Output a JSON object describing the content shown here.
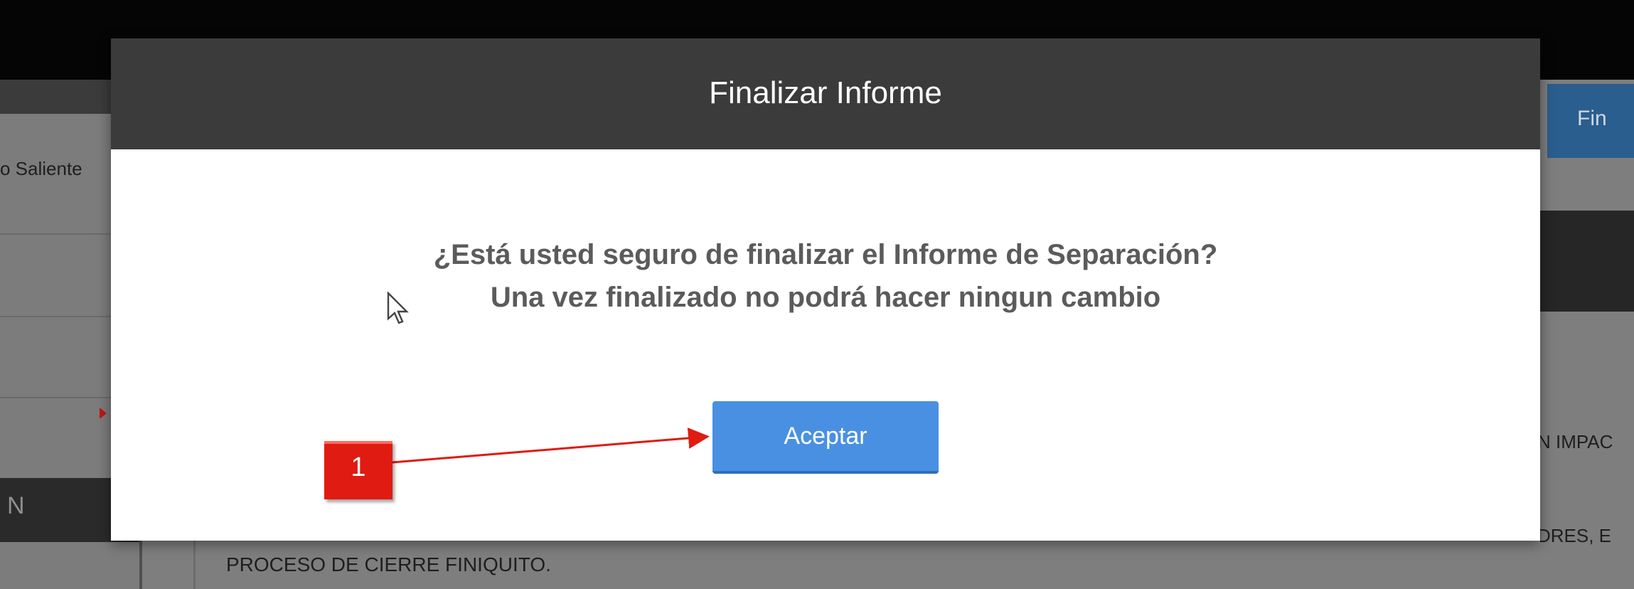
{
  "background": {
    "left_item": "o Saliente",
    "left_dark_text": "N",
    "right_button": "Fin",
    "right_text_1": "N IMPAC",
    "right_text_2": "DRES, E",
    "bottom_text": "PROCESO DE CIERRE FINIQUITO."
  },
  "modal": {
    "title": "Finalizar Informe",
    "message_line1": "¿Está usted seguro de finalizar el Informe de Separación?",
    "message_line2": "Una vez finalizado no podrá hacer ningun cambio",
    "accept_label": "Aceptar"
  },
  "annotation": {
    "number": "1",
    "color": "#e01b12"
  },
  "colors": {
    "header": "#3b3b3b",
    "button": "#4a90e2",
    "message": "#5b5b5b"
  }
}
